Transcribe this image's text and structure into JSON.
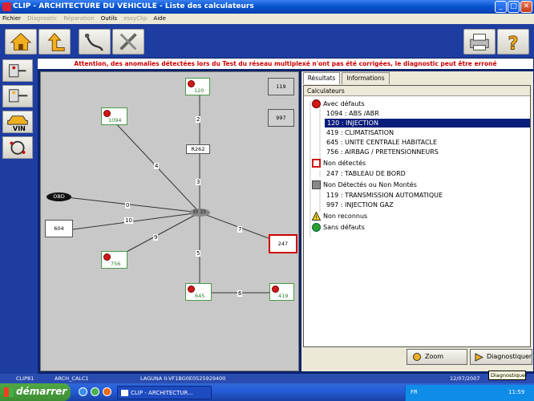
{
  "window": {
    "title": "CLIP - ARCHITECTURE DU VEHICULE - Liste des calculateurs",
    "min": "_",
    "max": "□",
    "close": "✕"
  },
  "menu": [
    {
      "label": "Fichier",
      "enabled": true
    },
    {
      "label": "Diagnostic",
      "enabled": false
    },
    {
      "label": "Réparation",
      "enabled": false
    },
    {
      "label": "Outils",
      "enabled": true
    },
    {
      "label": "essyClip",
      "enabled": false
    },
    {
      "label": "Aide",
      "enabled": true
    }
  ],
  "warning": "Attention, des anomalies détectées lors du Test du réseau multiplexé n'ont pas été corrigées, le diagnostic peut être erroné",
  "side_vin": "VIN",
  "diagram": {
    "hub": "Et 33",
    "obd": "OBD",
    "r262": "R262",
    "n120": "120",
    "n1094": "1094",
    "n756": "756",
    "n645": "645",
    "n419": "419",
    "b119": "119",
    "b997": "997",
    "b604": "604",
    "b247": "247",
    "l2": "2",
    "l3": "3",
    "l4": "4",
    "l0": "0",
    "l10": "10",
    "l9": "9",
    "l5": "5",
    "l7": "7",
    "l6": "6"
  },
  "tabs": [
    "Résultats",
    "Informations"
  ],
  "tree": {
    "header": "Calculateurs",
    "g1": "Avec défauts",
    "i1094": "1094 : ABS /ABR",
    "i120": "120 : INJECTION",
    "i419": "419 : CLIMATISATION",
    "i645": "645 : UNITE CENTRALE HABITACLE",
    "i756": "756 : AIRBAG / PRETENSIONNEURS",
    "g2": "Non détectés",
    "i247": "247 : TABLEAU DE BORD",
    "g3": "Non Détectés ou Non Montés",
    "i119": "119 : TRANSMISSION AUTOMATIQUE",
    "i997": "997 : INJECTION GAZ",
    "g4": "Non reconnus",
    "g5": "Sans défauts"
  },
  "buttons": {
    "zoom": "Zoom",
    "diag": "Diagnostiquer"
  },
  "tooltip": "Diagnostiquer",
  "status": {
    "a": "CLIP81",
    "b": "ARCH_CALC1",
    "c": "LAGUNA II-VF1BG0E0525929400",
    "d": "12/07/2007"
  },
  "taskbar": {
    "start": "démarrer",
    "task": "CLIP - ARCHITECTUR...",
    "lang": "FR",
    "time": "11:59"
  },
  "colors": {
    "fault": "#d01818",
    "ok": "#2aa02a",
    "title": "#0a246a"
  }
}
